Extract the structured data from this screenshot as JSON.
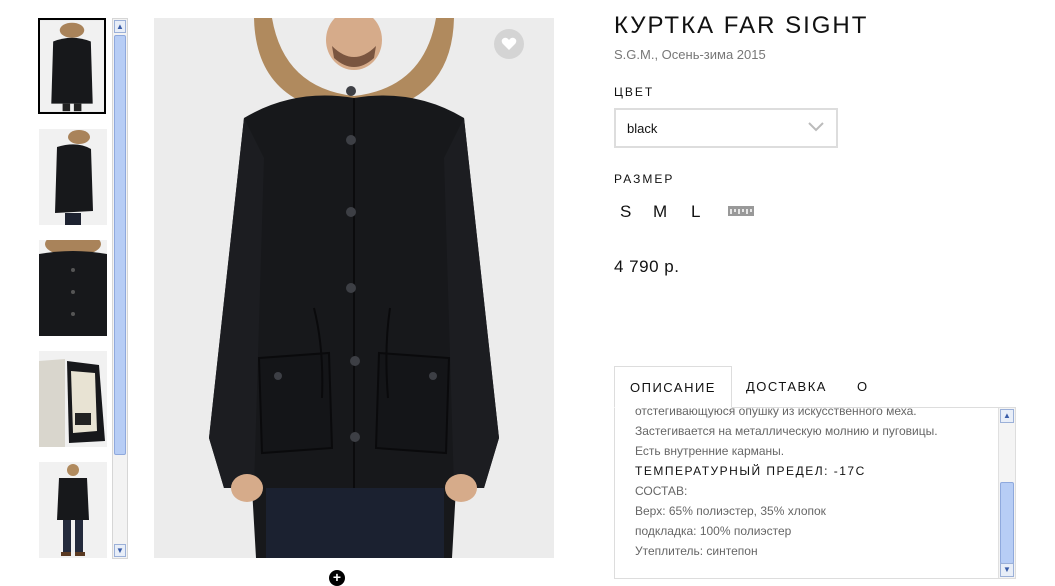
{
  "product": {
    "title": "КУРТКА FAR SIGHT",
    "brand_season": "S.G.M., Осень-зима 2015",
    "color_label": "ЦВЕТ",
    "color_value": "black",
    "size_label": "РАЗМЕР",
    "sizes": [
      "S",
      "M",
      "L"
    ],
    "price": "4 790 р."
  },
  "tabs": [
    "ОПИСАНИЕ",
    "ДОСТАВКА",
    "О БРЕНДЕ"
  ],
  "description": {
    "line_top": "отстегивающуюся опушку из искусственного меха.",
    "line_2": "Застегивается на металлическую молнию и пуговицы.",
    "line_3": "Есть внутренние карманы.",
    "temp_heading": "ТЕМПЕРАТУРНЫЙ ПРЕДЕЛ: -17С",
    "composition_label": "СОСТАВ:",
    "outer": "Верх: 65% полиэстер, 35% хлопок",
    "lining": "подкладка: 100% полиэстер",
    "insulation": "Утеплитель: синтепон"
  },
  "icons": {
    "favorite": "heart-icon",
    "color_dropdown": "chevron-down-icon",
    "size_chart": "ruler-icon",
    "zoom": "plus-circle-icon"
  },
  "colors": {
    "jacket": "#17181b",
    "fur": "#b08a5e",
    "background": "#ececec",
    "scrollbar": "#b7cdf5"
  }
}
